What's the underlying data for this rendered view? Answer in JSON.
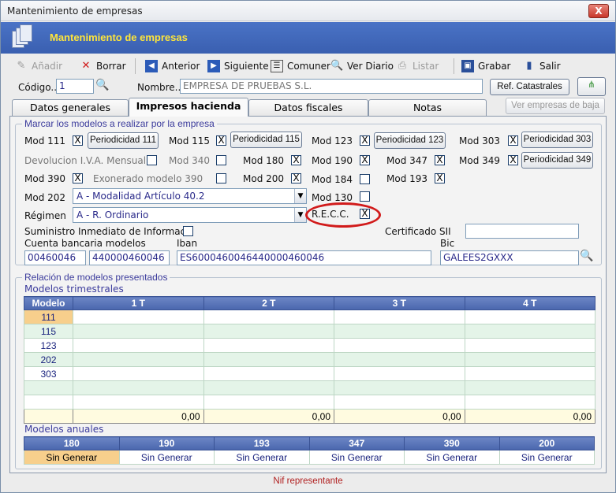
{
  "window": {
    "title": "Mantenimiento de empresas",
    "close": "X"
  },
  "header": {
    "title": "Mantenimiento de empresas"
  },
  "toolbar": {
    "anadir": "Añadir",
    "borrar": "Borrar",
    "anterior": "Anterior",
    "siguiente": "Siguiente",
    "comuner": "Comuner",
    "ver_diario": "Ver Diario",
    "listar": "Listar",
    "grabar": "Grabar",
    "salir": "Salir"
  },
  "codigo": {
    "label": "Código..",
    "value": "1"
  },
  "nombre": {
    "label": "Nombre..",
    "value": "EMPRESA DE PRUEBAS S.L."
  },
  "ref_catastrales": "Ref. Catastrales",
  "ver_empresas_baja": "Ver empresas de baja",
  "tabs": [
    "Datos generales",
    "Impresos hacienda",
    "Datos fiscales",
    "Notas"
  ],
  "marcar": {
    "title": "Marcar los modelos a realizar por la empresa",
    "check": "X",
    "mod111": "Mod 111",
    "per111": "Periodicidad 111",
    "mod115": "Mod 115",
    "per115": "Periodicidad 115",
    "mod123": "Mod 123",
    "per123": "Periodicidad 123",
    "mod303": "Mod 303",
    "per303": "Periodicidad 303",
    "devolucion": "Devolucion I.V.A. Mensual",
    "mod340": "Mod 340",
    "mod180": "Mod 180",
    "mod190": "Mod 190",
    "mod347": "Mod 347",
    "mod349": "Mod 349",
    "per349": "Periodicidad 349",
    "mod390": "Mod 390",
    "exonerado": "Exonerado modelo 390",
    "mod200": "Mod 200",
    "mod184": "Mod 184",
    "mod193": "Mod 193",
    "mod202": "Mod 202",
    "mod202_value": "A - Modalidad Artículo 40.2",
    "mod130": "Mod 130",
    "regimen": "Régimen",
    "regimen_value": "A - R. Ordinario",
    "recc": "R.E.C.C.",
    "sii": "Suministro Inmediato de Informaci",
    "certificado": "Certificado SII",
    "certificado_value": "",
    "cuenta": "Cuenta bancaria modelos",
    "cuenta1": "00460046",
    "cuenta2": "440000460046",
    "iban": "Iban",
    "iban_value": "ES6000460046440000460046",
    "bic": "Bic",
    "bic_value": "GALEES2GXXX"
  },
  "relacion": {
    "title": "Relación de modelos presentados",
    "trimestrales": "Modelos trimestrales",
    "headers": [
      "Modelo",
      "1 T",
      "2 T",
      "3 T",
      "4 T"
    ],
    "rows": [
      "111",
      "115",
      "123",
      "202",
      "303"
    ],
    "totals": [
      "0,00",
      "0,00",
      "0,00",
      "0,00"
    ],
    "anuales": "Modelos anuales",
    "anual_headers": [
      "180",
      "190",
      "193",
      "347",
      "390",
      "200"
    ],
    "anual_values": [
      "Sin Generar",
      "Sin Generar",
      "Sin Generar",
      "Sin Generar",
      "Sin Generar",
      "Sin Generar"
    ]
  },
  "footer": "Nif representante"
}
